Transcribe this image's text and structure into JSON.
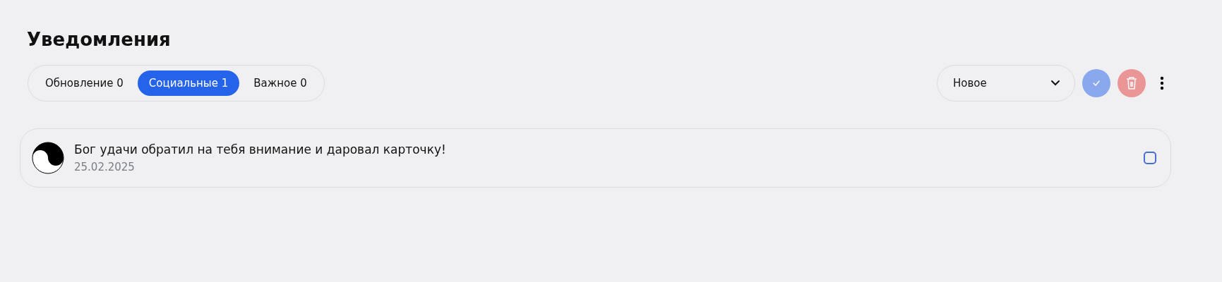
{
  "title": "Уведомления",
  "tabs": [
    {
      "label": "Обновление 0",
      "selected": false
    },
    {
      "label": "Социальные 1",
      "selected": true
    },
    {
      "label": "Важное 0",
      "selected": false
    }
  ],
  "sort": {
    "value": "Новое"
  },
  "actions": {
    "mark_read_disabled": true,
    "delete_disabled": true
  },
  "notifications": [
    {
      "text": "Бог удачи обратил на тебя внимание и даровал карточку!",
      "date": "25.02.2025",
      "checked": false
    }
  ]
}
